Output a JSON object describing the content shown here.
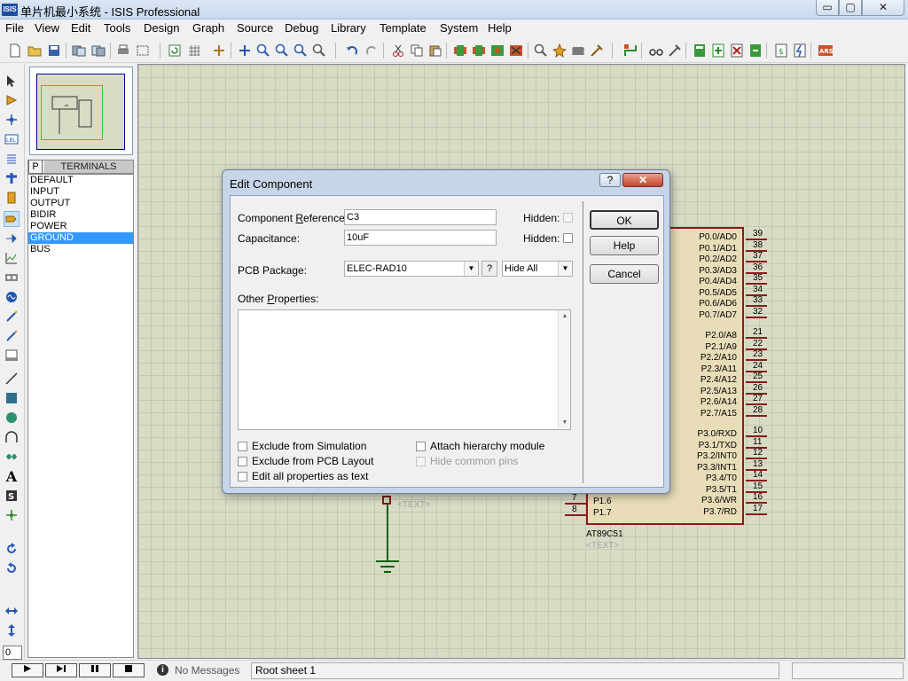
{
  "window": {
    "app_icon": "ISIS",
    "title": "单片机最小系统 - ISIS Professional",
    "min": "▭",
    "max": "▢",
    "close": "✕"
  },
  "menu": [
    "File",
    "View",
    "Edit",
    "Tools",
    "Design",
    "Graph",
    "Source",
    "Debug",
    "Library",
    "Template",
    "System",
    "Help"
  ],
  "terminals": {
    "mode_button": "P",
    "header": "TERMINALS",
    "items": [
      "DEFAULT",
      "INPUT",
      "OUTPUT",
      "BIDIR",
      "POWER",
      "GROUND",
      "BUS"
    ],
    "selected": "GROUND"
  },
  "rotation_value": "0",
  "chip": {
    "name": "AT89C51",
    "text": "<TEXT>",
    "pins_right": [
      {
        "label": "P0.0/AD0",
        "num": "39"
      },
      {
        "label": "P0.1/AD1",
        "num": "38"
      },
      {
        "label": "P0.2/AD2",
        "num": "37"
      },
      {
        "label": "P0.3/AD3",
        "num": "36"
      },
      {
        "label": "P0.4/AD4",
        "num": "35"
      },
      {
        "label": "P0.5/AD5",
        "num": "34"
      },
      {
        "label": "P0.6/AD6",
        "num": "33"
      },
      {
        "label": "P0.7/AD7",
        "num": "32"
      },
      {
        "label": "P2.0/A8",
        "num": "21"
      },
      {
        "label": "P2.1/A9",
        "num": "22"
      },
      {
        "label": "P2.2/A10",
        "num": "23"
      },
      {
        "label": "P2.3/A11",
        "num": "24"
      },
      {
        "label": "P2.4/A12",
        "num": "25"
      },
      {
        "label": "P2.5/A13",
        "num": "26"
      },
      {
        "label": "P2.6/A14",
        "num": "27"
      },
      {
        "label": "P2.7/A15",
        "num": "28"
      },
      {
        "label": "P3.0/RXD",
        "num": "10"
      },
      {
        "label": "P3.1/TXD",
        "num": "11"
      },
      {
        "label": "P3.2/INT0",
        "num": "12"
      },
      {
        "label": "P3.3/INT1",
        "num": "13"
      },
      {
        "label": "P3.4/T0",
        "num": "14"
      },
      {
        "label": "P3.5/T1",
        "num": "15"
      },
      {
        "label": "P3.6/WR",
        "num": "16"
      },
      {
        "label": "P3.7/RD",
        "num": "17"
      }
    ],
    "pins_left": [
      {
        "label": "P1.6",
        "num": "7"
      },
      {
        "label": "P1.7",
        "num": "8"
      }
    ]
  },
  "capacitor_text": "<TEXT>",
  "status": {
    "messages": "No Messages",
    "sheet": "Root sheet 1",
    "info_icon": "i"
  },
  "dialog": {
    "title": "Edit Component",
    "help_glyph": "?",
    "close_glyph": "✕",
    "component_reference_label": "Component Reference:",
    "component_reference_value": "C3",
    "capacitance_label": "Capacitance:",
    "capacitance_value": "10uF",
    "hidden_label": "Hidden:",
    "pcb_package_label": "PCB Package:",
    "pcb_package_value": "ELEC-RAD10",
    "pcb_help": "?",
    "hide_all_value": "Hide All",
    "other_properties_label": "Other Properties:",
    "ok": "OK",
    "help": "Help",
    "cancel": "Cancel",
    "exclude_simulation": "Exclude from Simulation",
    "exclude_pcb": "Exclude from PCB Layout",
    "edit_all_text": "Edit all properties as text",
    "attach_hierarchy": "Attach hierarchy module",
    "hide_common_pins": "Hide common pins"
  }
}
